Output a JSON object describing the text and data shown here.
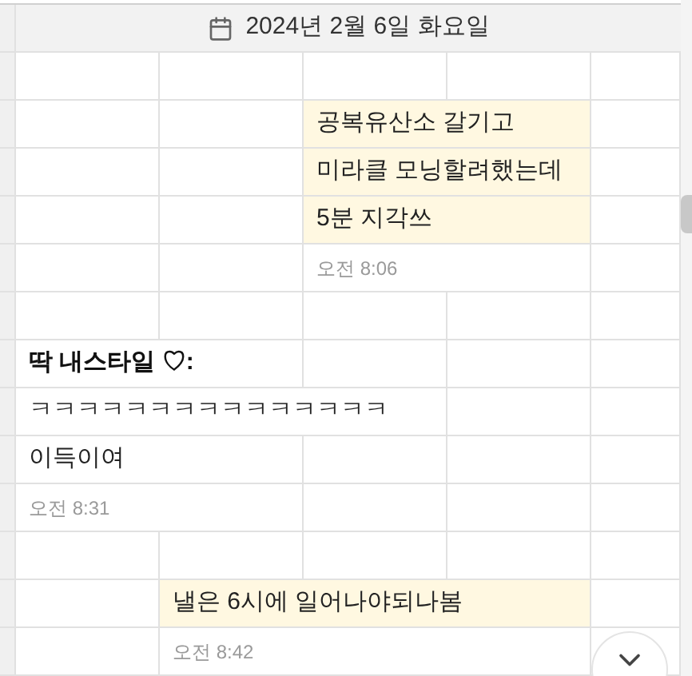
{
  "date_header": "2024년 2월 6일 화요일",
  "messages": [
    {
      "kind": "sent",
      "lines": [
        "공복유산소 갈기고",
        "미라클 모닝할려했는데",
        "5분 지각쓰"
      ],
      "time": "오전 8:06"
    },
    {
      "kind": "received",
      "sender": "딱 내스타일 ♡:",
      "lines": [
        "ㅋㅋㅋㅋㅋㅋㅋㅋㅋㅋㅋㅋㅋㅋㅋ",
        "이득이여"
      ],
      "time": "오전 8:31"
    },
    {
      "kind": "sent",
      "lines": [
        "낼은 6시에 일어나야되나봄"
      ],
      "time": "오전 8:42"
    }
  ]
}
